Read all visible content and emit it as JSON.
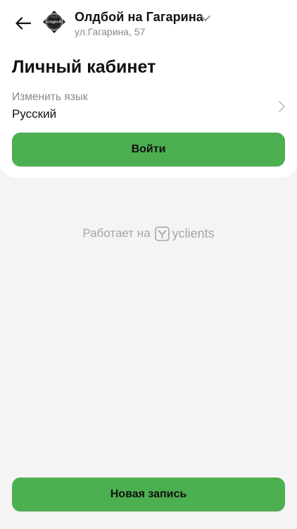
{
  "header": {
    "branch_name": "Олдбой на Гагарина",
    "branch_address": "ул.Гагарина, 57",
    "logo_text": "ОЛДБОЙ"
  },
  "profile": {
    "title": "Личный кабинет",
    "language_label": "Изменить язык",
    "language_value": "Русский",
    "login_label": "Войти"
  },
  "footer": {
    "powered_by_text": "Работает на",
    "powered_by_brand": "yclients",
    "new_booking_label": "Новая запись"
  },
  "icons": {
    "back": "arrow-left-icon",
    "dropdown": "chevron-down-icon",
    "language_chevron": "chevron-right-icon",
    "yclients_logo": "yclients-logo-icon"
  },
  "colors": {
    "accent": "#4caf50",
    "background": "#f4f4f4",
    "card": "#ffffff",
    "muted_text": "#8a8a8a"
  }
}
